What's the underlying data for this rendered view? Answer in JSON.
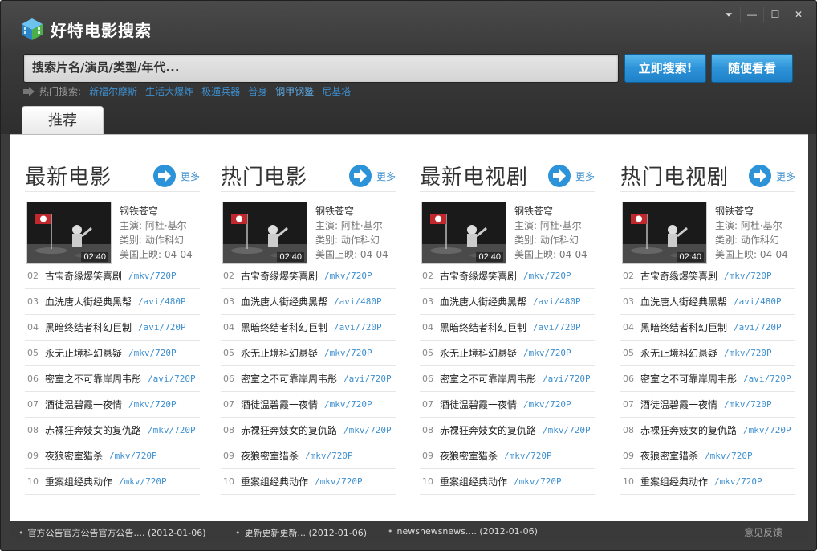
{
  "window": {
    "title": "好特电影搜索",
    "controls": [
      {
        "name": "skin-menu-button",
        "glyph": "⏷"
      },
      {
        "name": "minimize-button",
        "glyph": "—"
      },
      {
        "name": "maximize-button",
        "glyph": "☐"
      },
      {
        "name": "close-button",
        "glyph": "✕"
      }
    ]
  },
  "search": {
    "placeholder": "搜索片名/演员/类型/年代...",
    "search_button": "立即搜索!",
    "random_button": "随便看看"
  },
  "hot": {
    "label": "热门搜索:",
    "items": [
      "新福尔摩斯",
      "生活大爆炸",
      "极遁兵器",
      "普身",
      "钢甲钢鳌",
      "尼基塔"
    ],
    "active_index": 4
  },
  "tabs": {
    "recommend": "推荐"
  },
  "colors": {
    "accent": "#2d93d8",
    "link": "#3d8fd0",
    "header_bg": "#3a3a3a"
  },
  "columns": [
    {
      "title": "最新电影",
      "more": "更多",
      "feature": {
        "title": "钢铁苍穹",
        "actor": "主演: 阿杜·基尔",
        "genre": "类别: 动作科幻",
        "release": "美国上映: 04-04",
        "duration": "02:40"
      },
      "items": [
        {
          "num": "02",
          "name": "古宝奇缘爆笑喜剧",
          "fmt": "/mkv/720P"
        },
        {
          "num": "03",
          "name": "血洗唐人街经典黑帮",
          "fmt": "/avi/480P"
        },
        {
          "num": "04",
          "name": "黑暗终结者科幻巨制",
          "fmt": "/avi/720P"
        },
        {
          "num": "05",
          "name": "永无止境科幻悬疑",
          "fmt": "/mkv/720P"
        },
        {
          "num": "06",
          "name": "密室之不可靠岸周韦彤",
          "fmt": "/avi/720P"
        },
        {
          "num": "07",
          "name": "酒徒温碧霞一夜情",
          "fmt": "/mkv/720P"
        },
        {
          "num": "08",
          "name": "赤裸狂奔妓女的复仇路",
          "fmt": "/mkv/720P"
        },
        {
          "num": "09",
          "name": "夜狼密室猎杀",
          "fmt": "/mkv/720P"
        },
        {
          "num": "10",
          "name": "重案组经典动作",
          "fmt": "/mkv/720P"
        }
      ]
    },
    {
      "title": "热门电影",
      "more": "更多",
      "feature": {
        "title": "钢铁苍穹",
        "actor": "主演: 阿杜·基尔",
        "genre": "类别: 动作科幻",
        "release": "美国上映: 04-04",
        "duration": "02:40"
      },
      "items": [
        {
          "num": "02",
          "name": "古宝奇缘爆笑喜剧",
          "fmt": "/mkv/720P"
        },
        {
          "num": "03",
          "name": "血洗唐人街经典黑帮",
          "fmt": "/avi/480P"
        },
        {
          "num": "04",
          "name": "黑暗终结者科幻巨制",
          "fmt": "/avi/720P"
        },
        {
          "num": "05",
          "name": "永无止境科幻悬疑",
          "fmt": "/mkv/720P"
        },
        {
          "num": "06",
          "name": "密室之不可靠岸周韦彤",
          "fmt": "/avi/720P"
        },
        {
          "num": "07",
          "name": "酒徒温碧霞一夜情",
          "fmt": "/mkv/720P"
        },
        {
          "num": "08",
          "name": "赤裸狂奔妓女的复仇路",
          "fmt": "/mkv/720P"
        },
        {
          "num": "09",
          "name": "夜狼密室猎杀",
          "fmt": "/mkv/720P"
        },
        {
          "num": "10",
          "name": "重案组经典动作",
          "fmt": "/mkv/720P"
        }
      ]
    },
    {
      "title": "最新电视剧",
      "more": "更多",
      "feature": {
        "title": "钢铁苍穹",
        "actor": "主演: 阿杜·基尔",
        "genre": "类别: 动作科幻",
        "release": "美国上映: 04-04",
        "duration": "02:40"
      },
      "items": [
        {
          "num": "02",
          "name": "古宝奇缘爆笑喜剧",
          "fmt": "/mkv/720P"
        },
        {
          "num": "03",
          "name": "血洗唐人街经典黑帮",
          "fmt": "/avi/480P"
        },
        {
          "num": "04",
          "name": "黑暗终结者科幻巨制",
          "fmt": "/avi/720P"
        },
        {
          "num": "05",
          "name": "永无止境科幻悬疑",
          "fmt": "/mkv/720P"
        },
        {
          "num": "06",
          "name": "密室之不可靠岸周韦彤",
          "fmt": "/avi/720P"
        },
        {
          "num": "07",
          "name": "酒徒温碧霞一夜情",
          "fmt": "/mkv/720P"
        },
        {
          "num": "08",
          "name": "赤裸狂奔妓女的复仇路",
          "fmt": "/mkv/720P"
        },
        {
          "num": "09",
          "name": "夜狼密室猎杀",
          "fmt": "/mkv/720P"
        },
        {
          "num": "10",
          "name": "重案组经典动作",
          "fmt": "/mkv/720P"
        }
      ]
    },
    {
      "title": "热门电视剧",
      "more": "更多",
      "feature": {
        "title": "钢铁苍穹",
        "actor": "主演: 阿杜·基尔",
        "genre": "类别: 动作科幻",
        "release": "美国上映: 04-04",
        "duration": "02:40"
      },
      "items": [
        {
          "num": "02",
          "name": "古宝奇缘爆笑喜剧",
          "fmt": "/mkv/720P"
        },
        {
          "num": "03",
          "name": "血洗唐人街经典黑帮",
          "fmt": "/avi/480P"
        },
        {
          "num": "04",
          "name": "黑暗终结者科幻巨制",
          "fmt": "/avi/720P"
        },
        {
          "num": "05",
          "name": "永无止境科幻悬疑",
          "fmt": "/mkv/720P"
        },
        {
          "num": "06",
          "name": "密室之不可靠岸周韦彤",
          "fmt": "/avi/720P"
        },
        {
          "num": "07",
          "name": "酒徒温碧霞一夜情",
          "fmt": "/mkv/720P"
        },
        {
          "num": "08",
          "name": "赤裸狂奔妓女的复仇路",
          "fmt": "/mkv/720P"
        },
        {
          "num": "09",
          "name": "夜狼密室猎杀",
          "fmt": "/mkv/720P"
        },
        {
          "num": "10",
          "name": "重案组经典动作",
          "fmt": "/mkv/720P"
        }
      ]
    }
  ],
  "footer": {
    "news": [
      {
        "text": "官方公告官方公告官方公告.... (2012-01-06)"
      },
      {
        "text": "更新更新更新... (2012-01-06)"
      },
      {
        "text": "newsnewsnews.... (2012-01-06)"
      }
    ],
    "feedback": "意见反馈"
  }
}
